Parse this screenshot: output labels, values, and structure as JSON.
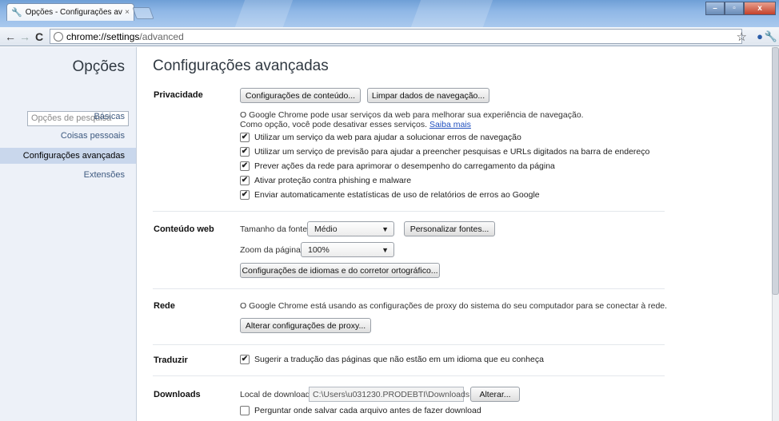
{
  "window": {
    "tab_title": "Opções - Configurações av.",
    "close_tab": "×",
    "minimize": "–",
    "maximize": "▫",
    "close": "x"
  },
  "toolbar": {
    "back": "←",
    "forward": "→",
    "reload": "C",
    "url_host": "chrome://settings",
    "url_path": "/advanced"
  },
  "sidebar": {
    "title": "Opções",
    "search_placeholder": "Opções de pesquisa",
    "items": [
      {
        "label": "Básicas"
      },
      {
        "label": "Coisas pessoais"
      },
      {
        "label": "Configurações avançadas"
      },
      {
        "label": "Extensões"
      }
    ]
  },
  "main": {
    "title": "Configurações avançadas",
    "privacy": {
      "label": "Privacidade",
      "content_settings_button": "Configurações de conteúdo...",
      "clear_data_button": "Limpar dados de navegação...",
      "description_line1": "O Google Chrome pode usar serviços da web para melhorar sua experiência de navegação.",
      "description_line2": "Como opção, você pode desativar esses serviços.",
      "learn_more": "Saiba mais",
      "options": [
        {
          "label": "Utilizar um serviço da web para ajudar a solucionar erros de navegação",
          "checked": true
        },
        {
          "label": "Utilizar um serviço de previsão para ajudar a preencher pesquisas e URLs digitados na barra de endereço",
          "checked": true
        },
        {
          "label": "Prever ações da rede para aprimorar o desempenho do carregamento da página",
          "checked": true
        },
        {
          "label": "Ativar proteção contra phishing e malware",
          "checked": true
        },
        {
          "label": "Enviar automaticamente estatísticas de uso de relatórios de erros ao Google",
          "checked": true
        }
      ]
    },
    "web_content": {
      "label": "Conteúdo web",
      "font_size_label": "Tamanho da fonte:",
      "font_size_value": "Médio",
      "customize_fonts_button": "Personalizar fontes...",
      "zoom_label": "Zoom da página:",
      "zoom_value": "100%",
      "languages_button": "Configurações de idiomas e do corretor ortográfico..."
    },
    "network": {
      "label": "Rede",
      "description": "O Google Chrome está usando as configurações de proxy do sistema do seu computador para se conectar à rede.",
      "proxy_button": "Alterar configurações de proxy..."
    },
    "translate": {
      "label": "Traduzir",
      "option": "Sugerir a tradução das páginas que não estão em um idioma que eu conheça",
      "checked": true
    },
    "downloads": {
      "label": "Downloads",
      "location_label": "Local de download:",
      "location_value": "C:\\Users\\u031230.PRODEBTI\\Downloads",
      "change_button": "Alterar...",
      "ask_option": "Perguntar onde salvar cada arquivo antes de fazer download",
      "ask_checked": false
    }
  },
  "icons": [
    "wrench-icon",
    "back-icon",
    "forward-icon",
    "reload-icon",
    "page-icon",
    "star-icon",
    "extension-icon",
    "wrench-menu-icon"
  ],
  "colors": {
    "sidebar_bg": "#edf1f8",
    "selected_item_bg": "#c9d7ec",
    "link": "#1f4fbf",
    "title_bar": "#8fb7e6"
  }
}
